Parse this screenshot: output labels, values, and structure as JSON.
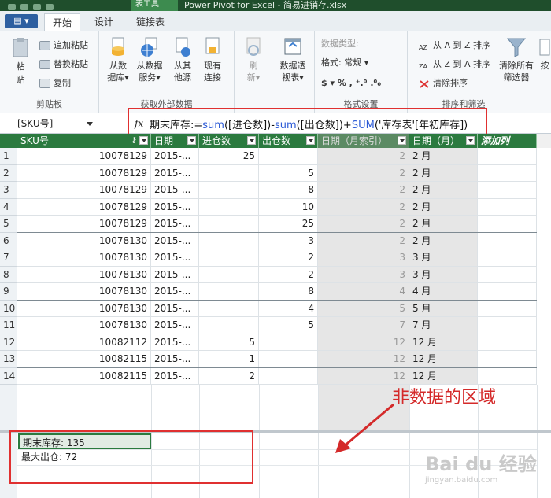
{
  "window": {
    "context_tab": "表工具",
    "title": "Power Pivot for Excel - 简易进销存.xlsx"
  },
  "tabs": [
    {
      "label": "开始",
      "active": true
    },
    {
      "label": "设计",
      "active": false
    },
    {
      "label": "链接表",
      "active": false
    }
  ],
  "ribbon": {
    "clipboard": {
      "paste": "粘贴",
      "append_paste": "追加粘贴",
      "replace_paste": "替换粘贴",
      "copy": "复制",
      "label": "剪贴板"
    },
    "external": {
      "from_db": "从数\n据库▾",
      "from_service": "从数据\n服务▾",
      "from_other": "从其\n他源",
      "existing": "现有\n连接",
      "label": "获取外部数据"
    },
    "refresh": "刷\n新▾",
    "pivot": "数据透\n视表▾",
    "format": {
      "data_type": "数据类型:",
      "format": "格式: 常规 ▾",
      "symbols": "$ ▾ %  ,  ⁺.⁰  .⁰₀",
      "label": "格式设置"
    },
    "sort": {
      "asc": "从 A 到 Z 排序",
      "desc": "从 Z 到 A 排序",
      "clear_sort": "清除排序",
      "clear_filter": "清除所有\n筛选器",
      "by": "按",
      "label": "排序和筛选"
    }
  },
  "formula_bar": {
    "name_box": "[SKU号]",
    "fx": "fx",
    "formula_name": "期末库存:=",
    "formula_fn1": "sum",
    "formula_a1": "([进仓数])-",
    "formula_fn2": "sum",
    "formula_a2": "([出仓数])+",
    "formula_fn3": "SUM",
    "formula_a3": "('库存表'[年初库存])"
  },
  "columns": [
    {
      "label": "SKU号"
    },
    {
      "label": "日期"
    },
    {
      "label": "进仓数"
    },
    {
      "label": "出仓数"
    },
    {
      "label": "日期（月索引）"
    },
    {
      "label": "日期（月）"
    },
    {
      "label": "添加列"
    }
  ],
  "rows": [
    {
      "n": "1",
      "sku": "10078129",
      "date": "2015-...",
      "in": "25",
      "out": "",
      "idx": "2",
      "month": "2 月"
    },
    {
      "n": "2",
      "sku": "10078129",
      "date": "2015-...",
      "in": "",
      "out": "5",
      "idx": "2",
      "month": "2 月"
    },
    {
      "n": "3",
      "sku": "10078129",
      "date": "2015-...",
      "in": "",
      "out": "8",
      "idx": "2",
      "month": "2 月"
    },
    {
      "n": "4",
      "sku": "10078129",
      "date": "2015-...",
      "in": "",
      "out": "10",
      "idx": "2",
      "month": "2 月"
    },
    {
      "n": "5",
      "sku": "10078129",
      "date": "2015-...",
      "in": "",
      "out": "25",
      "idx": "2",
      "month": "2 月"
    },
    {
      "n": "6",
      "sku": "10078130",
      "date": "2015-...",
      "in": "",
      "out": "3",
      "idx": "2",
      "month": "2 月"
    },
    {
      "n": "7",
      "sku": "10078130",
      "date": "2015-...",
      "in": "",
      "out": "2",
      "idx": "3",
      "month": "3 月"
    },
    {
      "n": "8",
      "sku": "10078130",
      "date": "2015-...",
      "in": "",
      "out": "2",
      "idx": "3",
      "month": "3 月"
    },
    {
      "n": "9",
      "sku": "10078130",
      "date": "2015-...",
      "in": "",
      "out": "8",
      "idx": "4",
      "month": "4 月"
    },
    {
      "n": "10",
      "sku": "10078130",
      "date": "2015-...",
      "in": "",
      "out": "4",
      "idx": "5",
      "month": "5 月"
    },
    {
      "n": "11",
      "sku": "10078130",
      "date": "2015-...",
      "in": "",
      "out": "5",
      "idx": "7",
      "month": "7 月"
    },
    {
      "n": "12",
      "sku": "10082112",
      "date": "2015-...",
      "in": "5",
      "out": "",
      "idx": "12",
      "month": "12 月"
    },
    {
      "n": "13",
      "sku": "10082115",
      "date": "2015-...",
      "in": "1",
      "out": "",
      "idx": "12",
      "month": "12 月"
    },
    {
      "n": "14",
      "sku": "10082115",
      "date": "2015-...",
      "in": "2",
      "out": "",
      "idx": "12",
      "month": "12 月"
    }
  ],
  "calc_area": {
    "measure1": "期末库存: 135",
    "measure2": "最大出仓: 72"
  },
  "annotation": "非数据的区域",
  "watermark": {
    "brand": "Bai du 经验",
    "url": "jingyan.baidu.com"
  },
  "colors": {
    "header_green": "#2b7a3f",
    "highlight_red": "#e03030"
  }
}
